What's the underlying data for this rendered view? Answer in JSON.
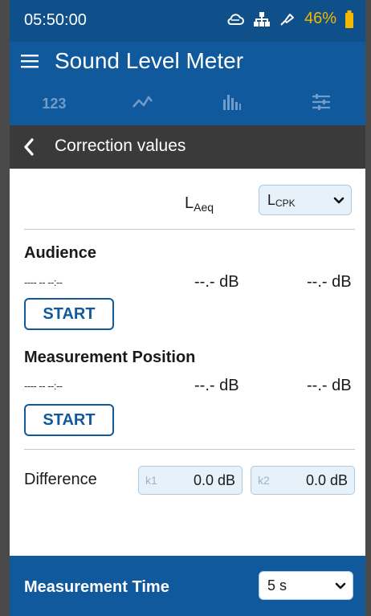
{
  "status_bar": {
    "time": "05:50:00",
    "battery_percent": "46%",
    "icons": [
      "cloud-icon",
      "network-icon",
      "satellite-icon",
      "battery-icon"
    ],
    "battery_color": "#f5b800"
  },
  "app_bar": {
    "title": "Sound Level Meter",
    "color": "#10599c"
  },
  "tabs": [
    {
      "label": "123",
      "icon": "numeric-tab"
    },
    {
      "icon": "line-chart-icon"
    },
    {
      "icon": "bar-chart-icon"
    },
    {
      "icon": "sliders-icon"
    }
  ],
  "section": {
    "title": "Correction values"
  },
  "header_row": {
    "laeq_main": "L",
    "laeq_sub": "Aeq",
    "select_main": "L",
    "select_sub": "CPK"
  },
  "audience": {
    "title": "Audience",
    "time_placeholder": "----  --  --:--",
    "value1": "--.- dB",
    "value2": "--.- dB",
    "start_label": "START"
  },
  "measurement_position": {
    "title": "Measurement Position",
    "time_placeholder": "----  --  --:--",
    "value1": "--.- dB",
    "value2": "--.- dB",
    "start_label": "START"
  },
  "difference": {
    "label": "Difference",
    "k1_label": "k1",
    "k1_value": "0.0 dB",
    "k2_label": "k2",
    "k2_value": "0.0 dB"
  },
  "measurement_time": {
    "label": "Measurement Time",
    "value": "5 s"
  }
}
